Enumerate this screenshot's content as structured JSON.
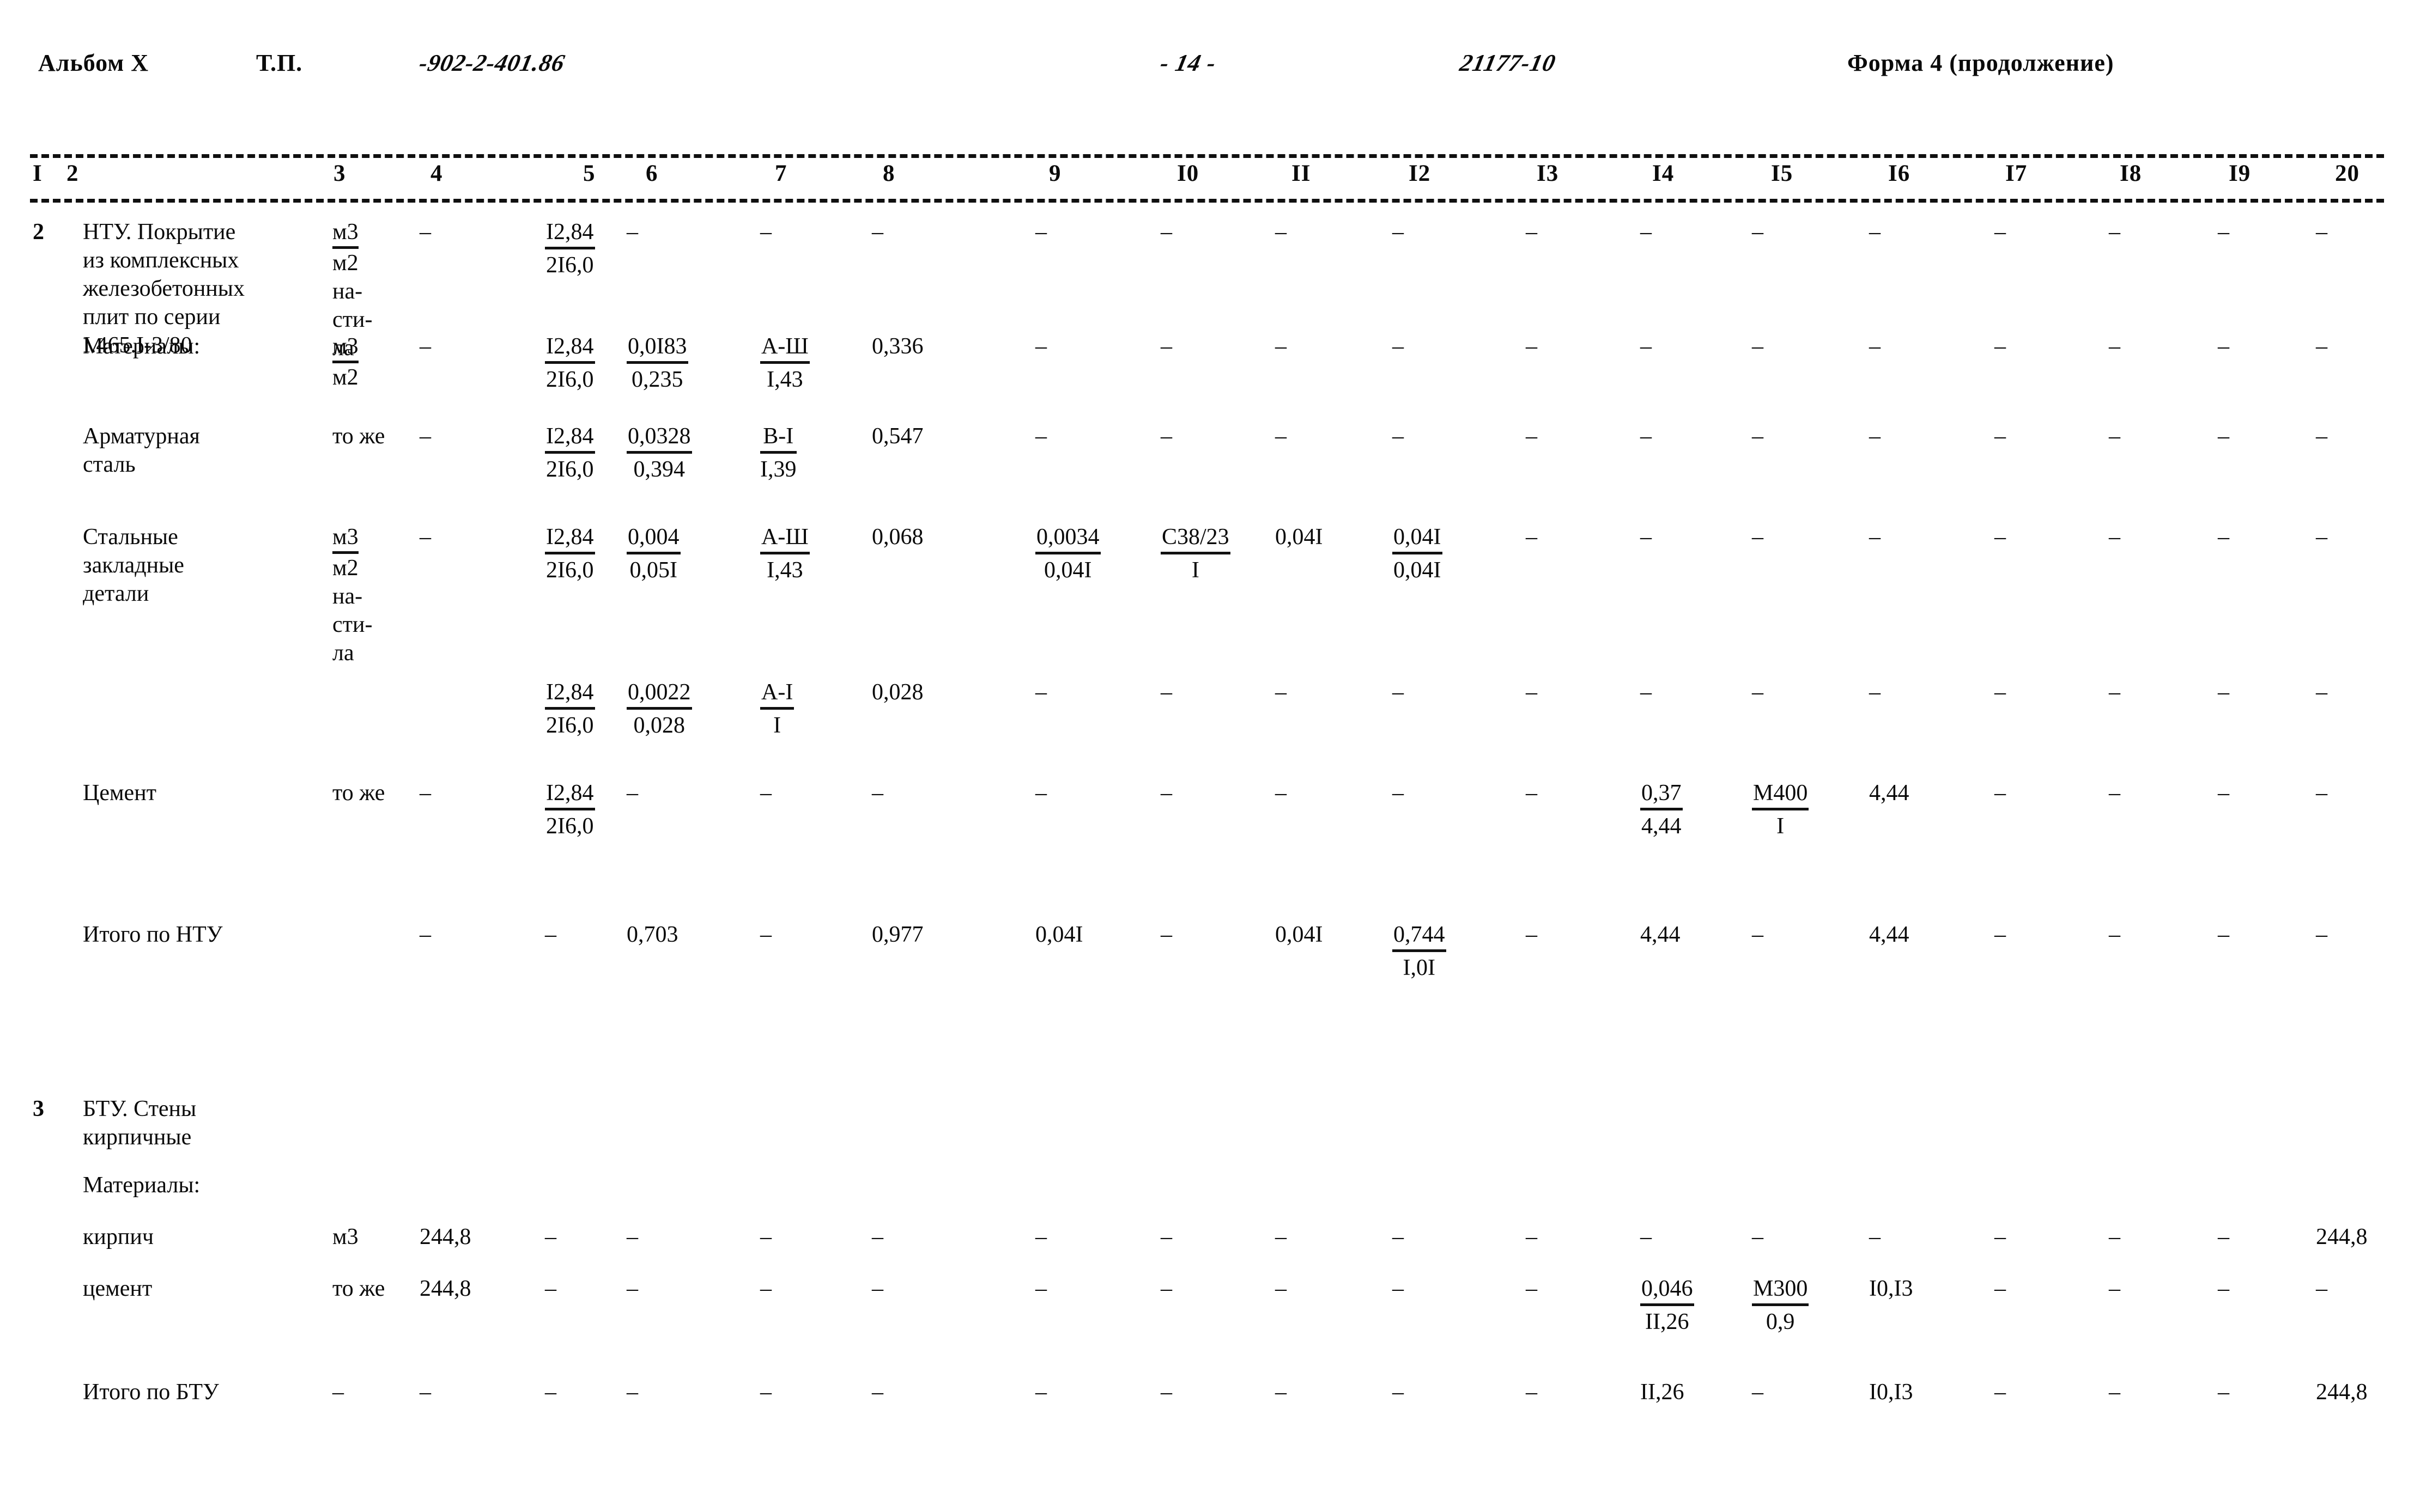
{
  "header": {
    "album_label": "Альбом X",
    "tp_label": "Т.П.",
    "project_code": "-902-2-401.86",
    "page_number": "- 14 -",
    "order_number": "21177-10",
    "form_label": "Форма 4 (продолжение)"
  },
  "column_numbers": [
    "I",
    "2",
    "3",
    "4",
    "5",
    "6",
    "7",
    "8",
    "9",
    "I0",
    "II",
    "I2",
    "I3",
    "I4",
    "I5",
    "I6",
    "I7",
    "I8",
    "I9",
    "20"
  ],
  "rows": [
    {
      "index": "2",
      "name": "НТУ. Покрытие\nиз комплексных\nжелезобетонных\nплит по серии\nI.465.I-3/80",
      "unit_top": "м3",
      "unit_bottom": "м2\nна-\nсти-\nла",
      "c4": "–",
      "c5_top": "I2,84",
      "c5_bot": "2I6,0",
      "c6": "–",
      "c7": "–",
      "c8": "–",
      "c9": "–",
      "c10": "–",
      "c11": "–",
      "c12": "–",
      "c13": "–",
      "c14": "–",
      "c15": "–",
      "c16": "–",
      "c17": "–",
      "c18": "–",
      "c19": "–",
      "c20": "–"
    },
    {
      "index": "",
      "name": "Материалы:",
      "unit_top": "м3",
      "unit_bottom": "м2",
      "c4": "–",
      "c5_top": "I2,84",
      "c5_bot": "2I6,0",
      "c6_top": "0,0I83",
      "c6_bot": "0,235",
      "c7_top": "А-Ш",
      "c7_bot": "I,43",
      "c8": "0,336",
      "c9": "–",
      "c10": "–",
      "c11": "–",
      "c12": "–",
      "c13": "–",
      "c14": "–",
      "c15": "–",
      "c16": "–",
      "c17": "–",
      "c18": "–",
      "c19": "–",
      "c20": "–"
    },
    {
      "index": "",
      "name": "Арматурная\nсталь",
      "unit_plain": "то же",
      "c4": "–",
      "c5_top": "I2,84",
      "c5_bot": "2I6,0",
      "c6_top": "0,0328",
      "c6_bot": "0,394",
      "c7_top": "В-I",
      "c7_bot": "I,39",
      "c8": "0,547",
      "c9": "–",
      "c10": "–",
      "c11": "–",
      "c12": "–",
      "c13": "–",
      "c14": "–",
      "c15": "–",
      "c16": "–",
      "c17": "–",
      "c18": "–",
      "c19": "–",
      "c20": "–"
    },
    {
      "index": "",
      "name": "Стальные\nзакладные\nдетали",
      "unit_top": "м3",
      "unit_bottom": "м2\nна-\nсти-\nла",
      "c4": "–",
      "c5_top": "I2,84",
      "c5_bot": "2I6,0",
      "c6_top": "0,004",
      "c6_bot": "0,05I",
      "c7_top": "А-Ш",
      "c7_bot": "I,43",
      "c8": "0,068",
      "c9_top": "0,0034",
      "c9_bot": "0,04I",
      "c10_top": "С38/23",
      "c10_bot": "I",
      "c11": "0,04I",
      "c12_top": "0,04I",
      "c12_bot": "0,04I",
      "c13": "–",
      "c14": "–",
      "c15": "–",
      "c16": "–",
      "c17": "–",
      "c18": "–",
      "c19": "–",
      "c20": "–"
    },
    {
      "index": "",
      "name": "",
      "c5_top": "I2,84",
      "c5_bot": "2I6,0",
      "c6_top": "0,0022",
      "c6_bot": "0,028",
      "c7_top": "А-I",
      "c7_bot": "I",
      "c8": "0,028",
      "c9": "–",
      "c10": "–",
      "c11": "–",
      "c12": "–",
      "c13": "–",
      "c14": "–",
      "c15": "–",
      "c16": "–",
      "c17": "–",
      "c18": "–",
      "c19": "–",
      "c20": "–"
    },
    {
      "index": "",
      "name": "Цемент",
      "unit_plain": "то же",
      "c4": "–",
      "c5_top": "I2,84",
      "c5_bot": "2I6,0",
      "c6": "–",
      "c7": "–",
      "c8": "–",
      "c9": "–",
      "c10": "–",
      "c11": "–",
      "c12": "–",
      "c13": "–",
      "c14_top": "0,37",
      "c14_bot": "4,44",
      "c15_top": "М400",
      "c15_bot": "I",
      "c16": "4,44",
      "c17": "–",
      "c18": "–",
      "c19": "–",
      "c20": "–"
    },
    {
      "index": "",
      "name": "Итого по НТУ",
      "c4": "–",
      "c5": "–",
      "c6": "0,703",
      "c7": "–",
      "c8": "0,977",
      "c9": "0,04I",
      "c10": "–",
      "c11": "0,04I",
      "c12_top": "0,744",
      "c12_bot": "I,0I",
      "c13": "–",
      "c14": "4,44",
      "c15": "–",
      "c16": "4,44",
      "c17": "–",
      "c18": "–",
      "c19": "–",
      "c20": "–"
    },
    {
      "index": "3",
      "name": "БТУ. Стены\nкирпичные"
    },
    {
      "index": "",
      "name": "Материалы:"
    },
    {
      "index": "",
      "name": "кирпич",
      "unit_plain": "м3",
      "c4": "244,8",
      "c5": "–",
      "c6": "–",
      "c7": "–",
      "c8": "–",
      "c9": "–",
      "c10": "–",
      "c11": "–",
      "c12": "–",
      "c13": "–",
      "c14": "–",
      "c15": "–",
      "c16": "–",
      "c17": "–",
      "c18": "–",
      "c19": "–",
      "c20": "244,8"
    },
    {
      "index": "",
      "name": "цемент",
      "unit_plain": "то же",
      "c4": "244,8",
      "c5": "–",
      "c6": "–",
      "c7": "–",
      "c8": "–",
      "c9": "–",
      "c10": "–",
      "c11": "–",
      "c12": "–",
      "c13": "–",
      "c14_top": "0,046",
      "c14_bot": "II,26",
      "c15_top": "М300",
      "c15_bot": "0,9",
      "c16": "I0,I3",
      "c17": "–",
      "c18": "–",
      "c19": "–",
      "c20": "–"
    },
    {
      "index": "",
      "name": "Итого по БТУ",
      "c3": "–",
      "c4": "–",
      "c5": "–",
      "c6": "–",
      "c7": "–",
      "c8": "–",
      "c9": "–",
      "c10": "–",
      "c11": "–",
      "c12": "–",
      "c13": "–",
      "c14": "II,26",
      "c15": "–",
      "c16": "I0,I3",
      "c17": "–",
      "c18": "–",
      "c19": "–",
      "c20": "244,8"
    }
  ]
}
